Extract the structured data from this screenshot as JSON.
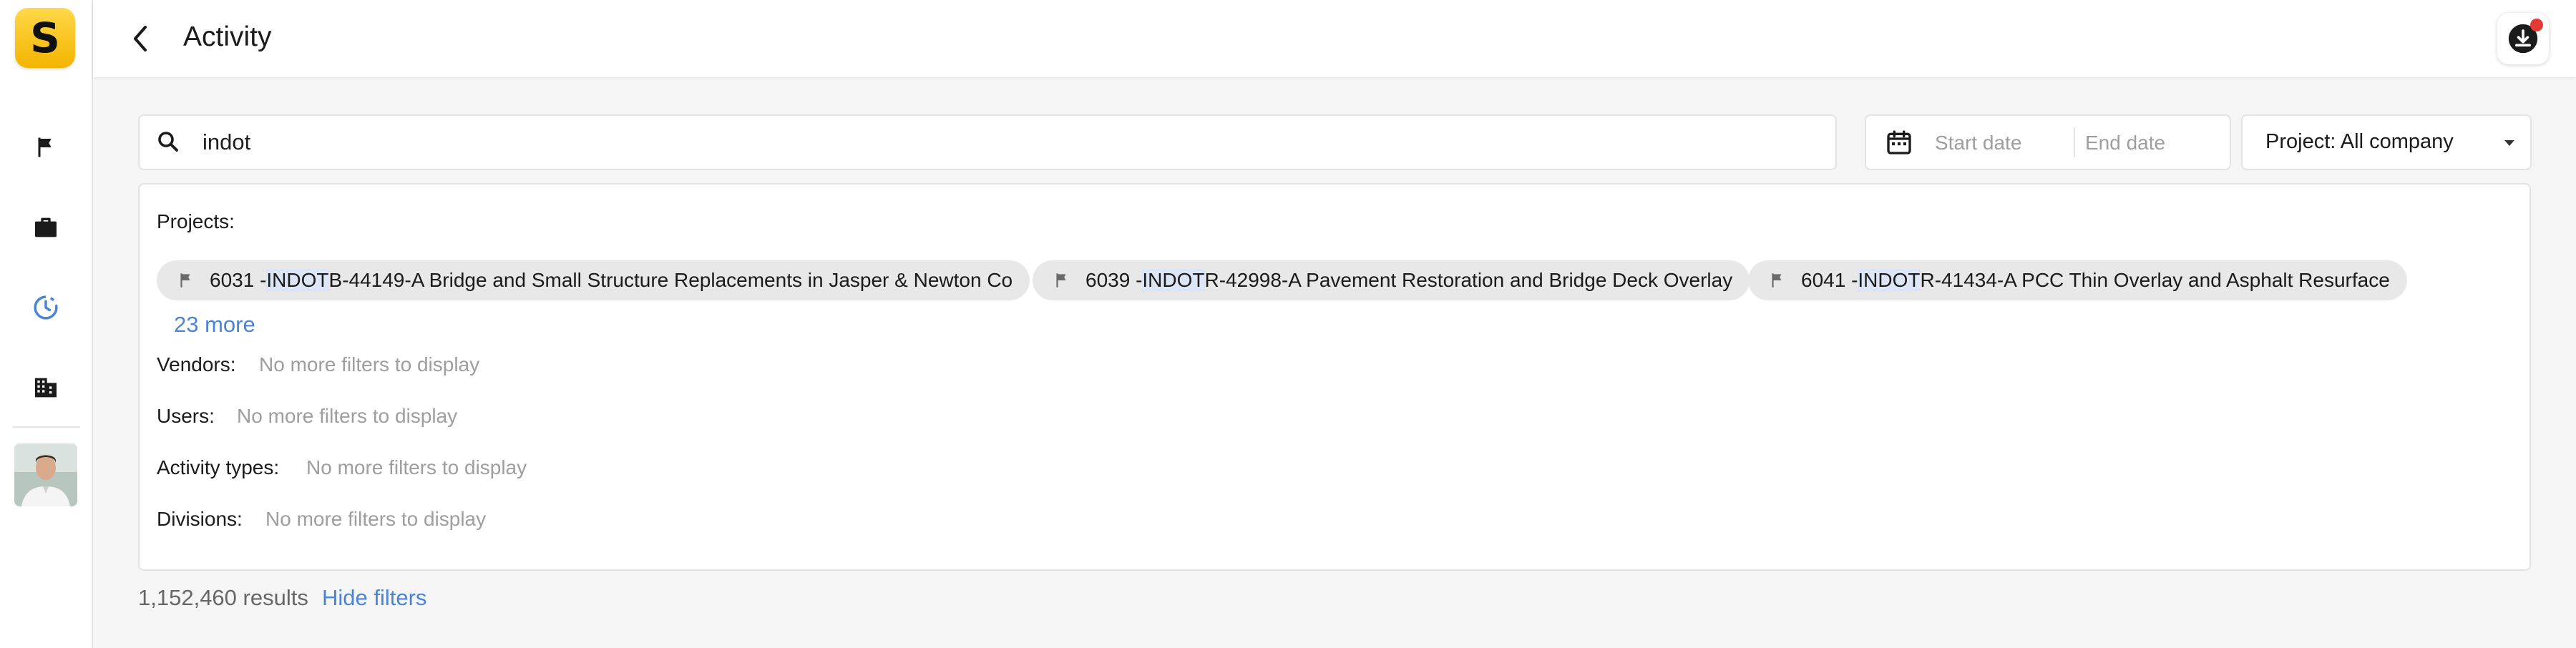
{
  "app": {
    "logo_letter": "S",
    "logo_color": "#f4b400"
  },
  "sidebar": {
    "items": [
      {
        "icon": "flag-icon",
        "active": false
      },
      {
        "icon": "briefcase-icon",
        "active": false
      },
      {
        "icon": "activity-clock-icon",
        "active": true
      },
      {
        "icon": "building-icon",
        "active": false
      }
    ],
    "accent": "#4a84d8"
  },
  "header": {
    "title": "Activity",
    "notification_dot_color": "#e53935"
  },
  "search": {
    "value": "indot"
  },
  "date_range": {
    "start_placeholder": "Start date",
    "end_placeholder": "End date"
  },
  "project_filter": {
    "label": "Project:",
    "value": "All company"
  },
  "filters": {
    "projects_label": "Projects:",
    "projects": [
      {
        "prefix": "6031 - ",
        "highlight": "INDOT",
        "suffix": " B-44149-A Bridge and Small Structure Replacements in Jasper & Newton Co"
      },
      {
        "prefix": "6039 - ",
        "highlight": "INDOT",
        "suffix": " R-42998-A Pavement Restoration and Bridge Deck Overlay"
      },
      {
        "prefix": "6041 - ",
        "highlight": "INDOT",
        "suffix": " R-41434-A PCC Thin Overlay and Asphalt Resurface"
      }
    ],
    "more_projects": "23 more",
    "vendors_label": "Vendors:",
    "users_label": "Users:",
    "activity_types_label": "Activity types:",
    "divisions_label": "Divisions:",
    "empty_text": "No more filters to display"
  },
  "footer": {
    "results": "1,152,460 results",
    "hide_filters": "Hide filters"
  }
}
